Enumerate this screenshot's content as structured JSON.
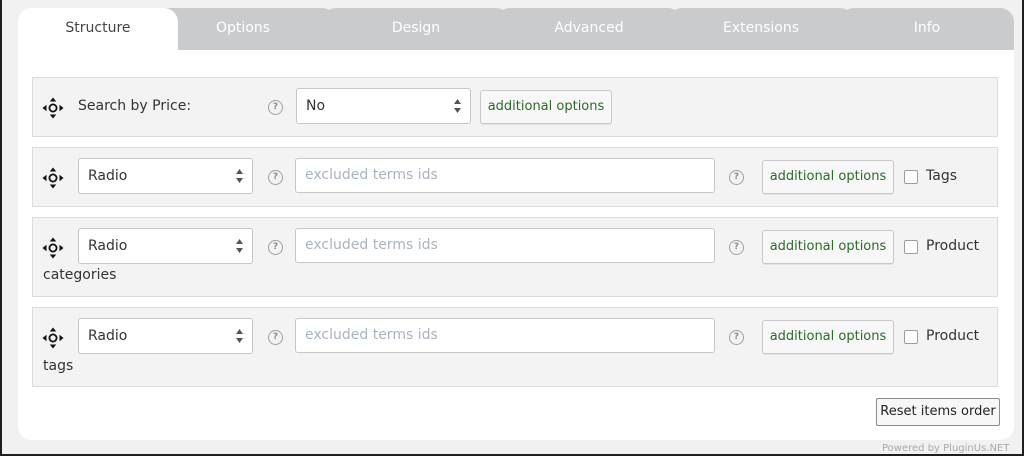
{
  "tabs": [
    {
      "label": "Structure",
      "active": true
    },
    {
      "label": "Options",
      "active": false
    },
    {
      "label": "Design",
      "active": false
    },
    {
      "label": "Advanced",
      "active": false
    },
    {
      "label": "Extensions",
      "active": false
    },
    {
      "label": "Info",
      "active": false
    }
  ],
  "rows": [
    {
      "label": "Search by Price:",
      "select_value": "No",
      "button": "additional options"
    },
    {
      "select_value": "Radio",
      "excluded_placeholder": "excluded terms ids",
      "button": "additional options",
      "checkbox_label": "Tags",
      "checked": false
    },
    {
      "select_value": "Radio",
      "excluded_placeholder": "excluded terms ids",
      "button": "additional options",
      "checkbox_label_line1": "Product",
      "checkbox_label_line2": "categories",
      "checked": false
    },
    {
      "select_value": "Radio",
      "excluded_placeholder": "excluded terms ids",
      "button": "additional options",
      "checkbox_label_line1": "Product",
      "checkbox_label_line2": "tags",
      "checked": false
    }
  ],
  "help_glyph": "?",
  "reset_button": "Reset items order",
  "powered_by": "Powered by PluginUs.NET",
  "icons": {
    "drag": "move-handle-icon",
    "help": "help-circle-icon",
    "select_arrows": "up-down-arrows-icon"
  },
  "colors": {
    "button_text": "#2a6a2a",
    "placeholder": "#a9b4bf",
    "tab_inactive": "#c9cbcd"
  }
}
